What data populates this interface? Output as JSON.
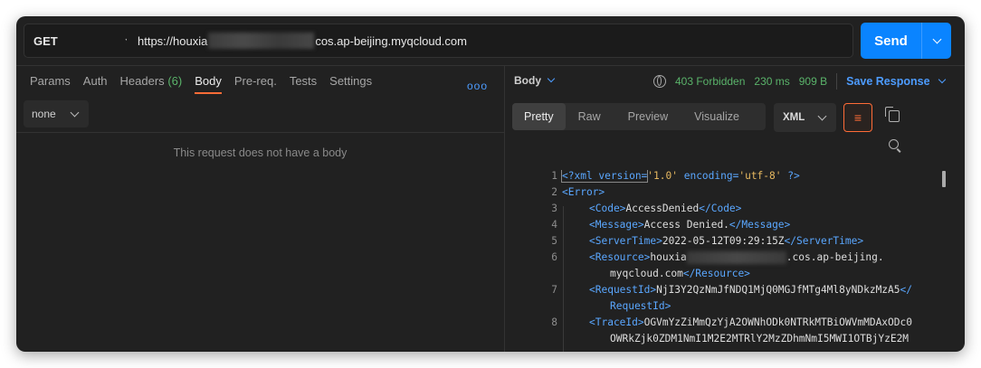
{
  "request": {
    "method": "GET",
    "url_prefix": "https://houxia",
    "url_suffix": "cos.ap-beijing.myqcloud.com",
    "send_label": "Send"
  },
  "left_tabs": [
    {
      "label": "Params"
    },
    {
      "label": "Auth"
    },
    {
      "label": "Headers",
      "count": "(6)"
    },
    {
      "label": "Body",
      "active": true
    },
    {
      "label": "Pre-req."
    },
    {
      "label": "Tests"
    },
    {
      "label": "Settings"
    }
  ],
  "more_label": "ooo",
  "body_type": "none",
  "empty_message": "This request does not have a body",
  "response": {
    "section_label": "Body",
    "status": "403 Forbidden",
    "time": "230 ms",
    "size": "909 B",
    "save_label": "Save Response",
    "view_tabs": [
      "Pretty",
      "Raw",
      "Preview",
      "Visualize"
    ],
    "format": "XML",
    "wrap_icon": "≡"
  },
  "code": {
    "line_numbers": [
      "1",
      "2",
      "3",
      "4",
      "5",
      "6",
      "",
      "7",
      "",
      "8",
      ""
    ],
    "l1_pre": "<?xml version=",
    "l1_v1": "'1.0'",
    "l1_mid": " encoding=",
    "l1_v2": "'utf-8'",
    "l1_end": " ?>",
    "l2": "<Error>",
    "l3_open": "<Code>",
    "l3_val": "AccessDenied",
    "l3_close": "</Code>",
    "l4_open": "<Message>",
    "l4_val": "Access Denied.",
    "l4_close": "</Message>",
    "l5_open": "<ServerTime>",
    "l5_val": "2022-05-12T09:29:15Z",
    "l5_close": "</ServerTime>",
    "l6_open": "<Resource>",
    "l6_val": "houxia",
    "l6_val2": ".cos.ap-beijing.",
    "l6b_val": "myqcloud.com",
    "l6b_close": "</Resource>",
    "l7_open": "<RequestId>",
    "l7_val": "NjI3Y2QzNmJfNDQ1MjQ0MGJfMTg4Ml8yNDkzMzA5",
    "l7_close": "</",
    "l7b_close": "RequestId>",
    "l8_open": "<TraceId>",
    "l8_val": "OGVmYzZiMmQzYjA2OWNhODk0NTRkMTBiOWVmMDAxODc0",
    "l8b_val": "OWRkZjk0ZDM1NmI1M2E2MTRlY2MzZDhmNmI5MWI1OTBjYzE2M"
  }
}
